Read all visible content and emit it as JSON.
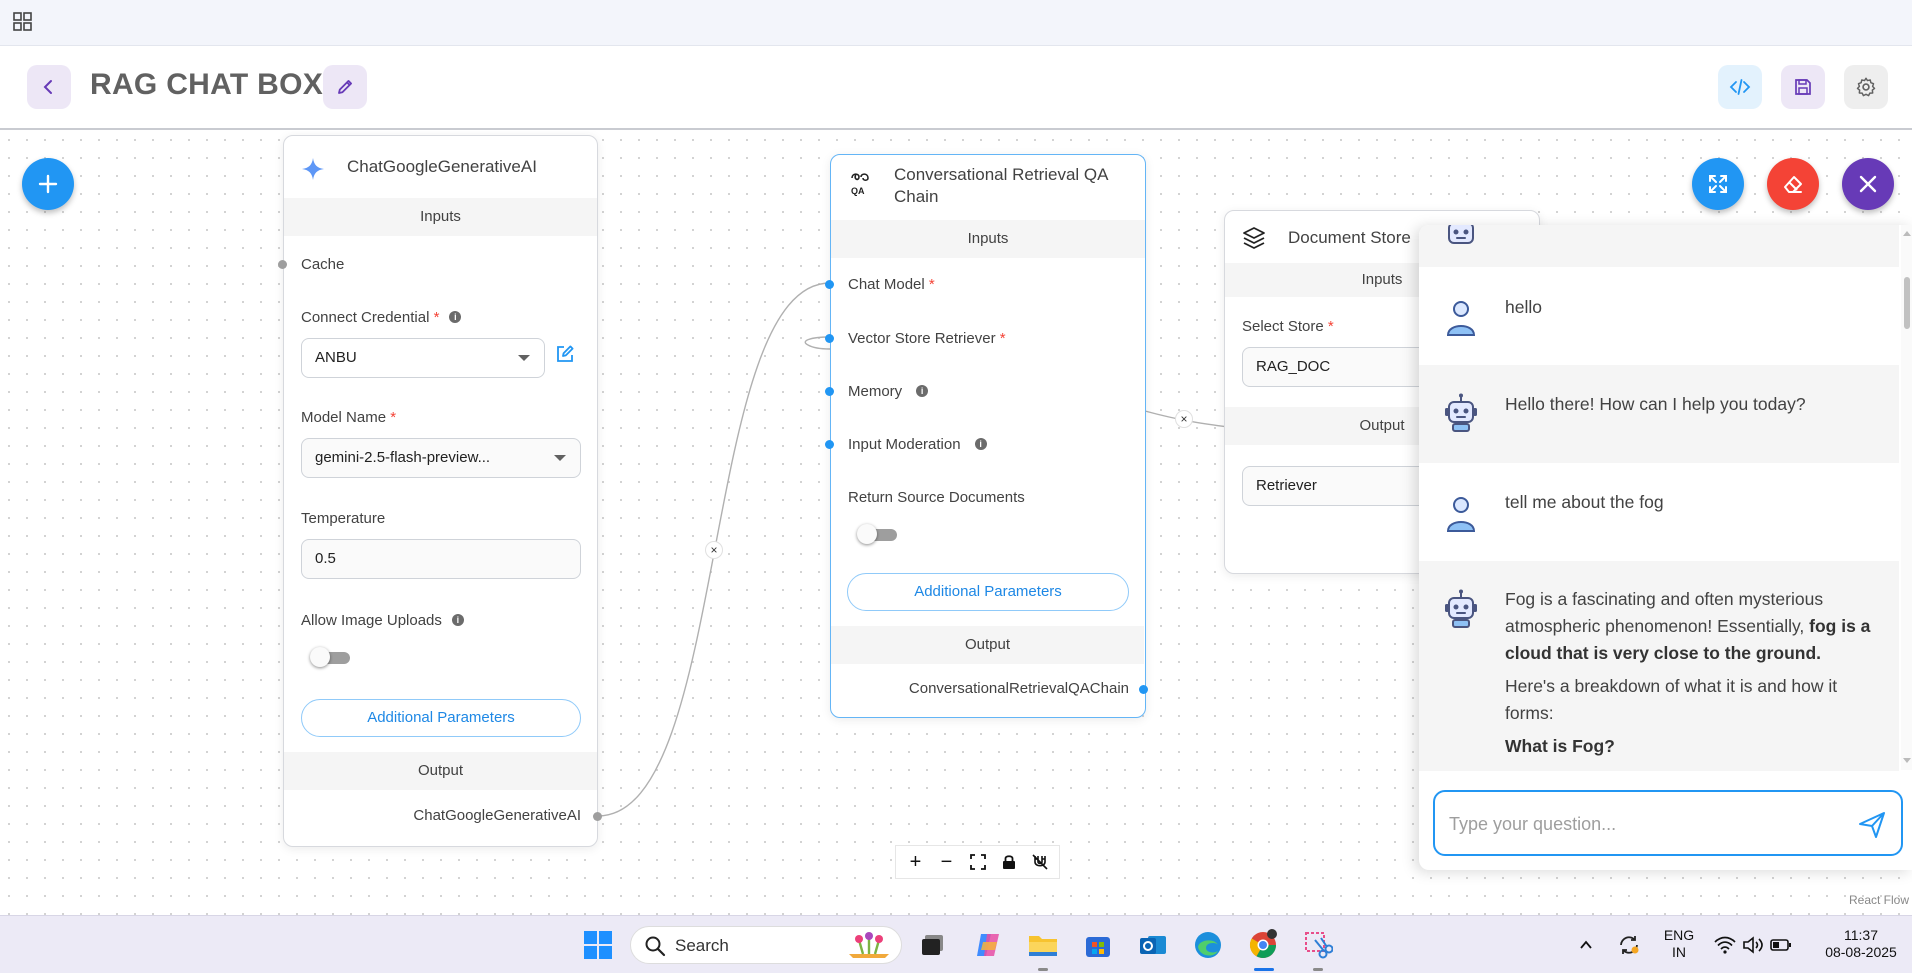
{
  "header": {
    "title": "RAG CHAT BOX"
  },
  "nodes": {
    "chat_google": {
      "title": "ChatGoogleGenerativeAI",
      "inputs_label": "Inputs",
      "cache_label": "Cache",
      "credential_label": "Connect Credential",
      "credential_value": "ANBU",
      "model_label": "Model Name",
      "model_value": "gemini-2.5-flash-preview...",
      "temperature_label": "Temperature",
      "temperature_value": "0.5",
      "image_uploads_label": "Allow Image Uploads",
      "additional_params": "Additional Parameters",
      "output_label": "Output",
      "output_value": "ChatGoogleGenerativeAI"
    },
    "qa_chain": {
      "title_line1": "Conversational Retrieval QA",
      "title_line2": "Chain",
      "inputs_label": "Inputs",
      "chat_model_label": "Chat Model",
      "retriever_label": "Vector Store Retriever",
      "memory_label": "Memory",
      "moderation_label": "Input Moderation",
      "return_source_label": "Return Source Documents",
      "additional_params": "Additional Parameters",
      "output_label": "Output",
      "output_value": "ConversationalRetrievalQAChain"
    },
    "doc_store": {
      "title": "Document Store",
      "inputs_label": "Inputs",
      "select_store_label": "Select Store",
      "select_store_value": "RAG_DOC",
      "output_label": "Output",
      "output_value": "Retriever"
    }
  },
  "chat": {
    "messages": [
      {
        "role": "user",
        "text": "hello"
      },
      {
        "role": "bot",
        "text": "Hello there! How can I help you today?"
      },
      {
        "role": "user",
        "text": "tell me about the fog"
      }
    ],
    "long_reply": {
      "part1": "Fog is a fascinating and often mysterious atmospheric phenomenon! Essentially, ",
      "bold": "fog is a cloud that is very close to the ground.",
      "para2": "Here's a breakdown of what it is and how it forms:",
      "heading": "What is Fog?"
    },
    "input_placeholder": "Type your question..."
  },
  "canvas": {
    "attribution": "React Flow"
  },
  "taskbar": {
    "search_text": "Search",
    "lang_line1": "ENG",
    "lang_line2": "IN",
    "time": "11:37",
    "date": "08-08-2025"
  },
  "colors": {
    "primary": "#2196f3",
    "danger": "#f44336",
    "purple": "#673ab7",
    "required": "#f44336"
  }
}
